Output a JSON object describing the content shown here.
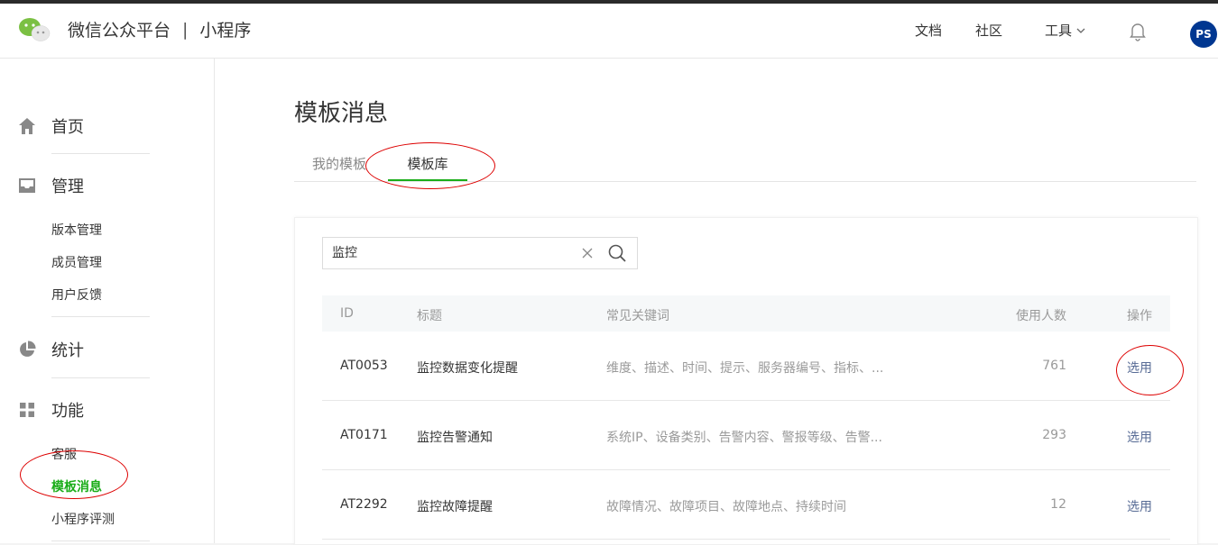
{
  "header": {
    "brand": "微信公众平台",
    "separator": "|",
    "product": "小程序",
    "nav": [
      "文档",
      "社区",
      "工具"
    ],
    "avatar_text": "PS"
  },
  "sidebar": {
    "groups": [
      {
        "label": "首页",
        "icon": "home-icon"
      },
      {
        "label": "管理",
        "icon": "inbox-icon",
        "items": [
          "版本管理",
          "成员管理",
          "用户反馈"
        ]
      },
      {
        "label": "统计",
        "icon": "pie-chart-icon"
      },
      {
        "label": "功能",
        "icon": "grid-icon",
        "items": [
          "客服",
          "模板消息",
          "小程序评测"
        ]
      }
    ],
    "active_item": "模板消息"
  },
  "main": {
    "title": "模板消息",
    "tabs": [
      "我的模板",
      "模板库"
    ],
    "active_tab": "模板库",
    "search": {
      "value": "监控"
    },
    "table": {
      "headers": [
        "ID",
        "标题",
        "常见关键词",
        "使用人数",
        "操作"
      ],
      "rows": [
        {
          "id": "AT0053",
          "title": "监控数据变化提醒",
          "keywords": "维度、描述、时间、提示、服务器编号、指标、...",
          "count": "761",
          "action": "选用"
        },
        {
          "id": "AT0171",
          "title": "监控告警通知",
          "keywords": "系统IP、设备类别、告警内容、警报等级、告警...",
          "count": "293",
          "action": "选用"
        },
        {
          "id": "AT2292",
          "title": "监控故障提醒",
          "keywords": "故障情况、故障项目、故障地点、持续时间",
          "count": "12",
          "action": "选用"
        }
      ]
    }
  },
  "colors": {
    "accent": "#1aad19",
    "link": "#576b95",
    "annotation": "#dd0000"
  }
}
